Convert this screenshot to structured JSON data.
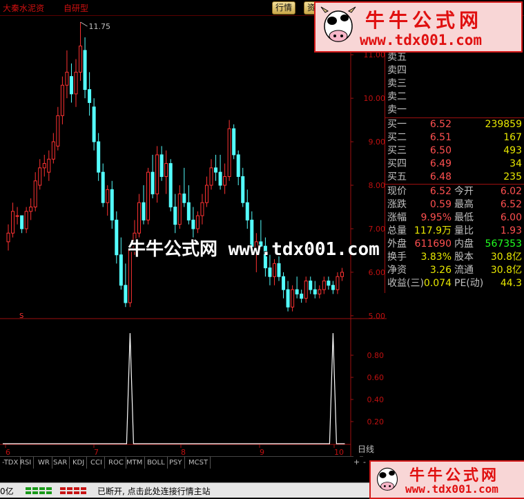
{
  "window": {
    "title": "大秦水泥资",
    "subtitle": "自研型"
  },
  "top_tabs": [
    {
      "label": "行情"
    },
    {
      "label": "资"
    }
  ],
  "chart_data": [
    {
      "type": "candlestick",
      "y_ticks": [
        "11.00",
        "10.00",
        "9.00",
        "8.00",
        "7.00",
        "6.00",
        "5.00"
      ],
      "ylim": [
        4.95,
        11.75
      ],
      "max_label": "11.75",
      "up_color": "#ff3232",
      "down_color": "#54ffff",
      "candles": [
        [
          6.7,
          7.1,
          6.5,
          6.9
        ],
        [
          6.9,
          7.6,
          6.8,
          7.4
        ],
        [
          7.3,
          7.5,
          7.1,
          7.3
        ],
        [
          7.3,
          7.2,
          6.9,
          7.0
        ],
        [
          7.0,
          7.5,
          6.9,
          7.4
        ],
        [
          7.4,
          7.7,
          7.2,
          7.5
        ],
        [
          7.5,
          8.3,
          7.4,
          8.1
        ],
        [
          8.0,
          8.6,
          7.9,
          8.4
        ],
        [
          8.4,
          8.7,
          8.2,
          8.5
        ],
        [
          8.3,
          8.8,
          8.1,
          8.6
        ],
        [
          8.6,
          9.2,
          8.5,
          9.0
        ],
        [
          8.9,
          9.8,
          8.8,
          9.6
        ],
        [
          9.6,
          10.5,
          9.4,
          10.3
        ],
        [
          10.3,
          11.1,
          10.0,
          10.6
        ],
        [
          10.5,
          10.8,
          9.9,
          10.1
        ],
        [
          10.1,
          10.9,
          9.8,
          10.6
        ],
        [
          10.6,
          11.75,
          10.4,
          11.2
        ],
        [
          11.1,
          11.4,
          10.0,
          10.2
        ],
        [
          10.2,
          10.6,
          9.6,
          9.9
        ],
        [
          9.8,
          10.0,
          8.8,
          9.0
        ],
        [
          9.0,
          9.2,
          8.1,
          8.3
        ],
        [
          8.3,
          8.5,
          7.5,
          7.6
        ],
        [
          7.6,
          8.0,
          7.3,
          7.9
        ],
        [
          7.9,
          8.1,
          7.0,
          7.2
        ],
        [
          7.2,
          7.4,
          6.2,
          6.4
        ],
        [
          6.4,
          6.8,
          5.6,
          5.7
        ],
        [
          5.7,
          6.2,
          5.2,
          5.3
        ],
        [
          5.3,
          6.6,
          5.2,
          6.5
        ],
        [
          6.5,
          7.2,
          6.4,
          6.9
        ],
        [
          6.9,
          7.8,
          6.8,
          7.6
        ],
        [
          7.6,
          8.0,
          7.1,
          7.2
        ],
        [
          7.2,
          8.4,
          7.1,
          8.3
        ],
        [
          8.3,
          8.7,
          7.7,
          7.8
        ],
        [
          7.8,
          8.9,
          7.6,
          8.7
        ],
        [
          8.7,
          8.9,
          8.1,
          8.2
        ],
        [
          8.2,
          8.8,
          7.8,
          8.5
        ],
        [
          8.5,
          8.6,
          7.4,
          7.5
        ],
        [
          7.5,
          7.8,
          6.9,
          7.1
        ],
        [
          7.1,
          8.0,
          7.0,
          7.8
        ],
        [
          7.8,
          8.4,
          7.5,
          7.6
        ],
        [
          7.6,
          8.0,
          7.1,
          7.2
        ],
        [
          7.2,
          7.5,
          6.8,
          7.0
        ],
        [
          7.0,
          7.4,
          6.9,
          7.3
        ],
        [
          7.3,
          7.8,
          7.1,
          7.6
        ],
        [
          7.6,
          8.2,
          7.5,
          8.0
        ],
        [
          8.0,
          8.6,
          7.9,
          8.4
        ],
        [
          8.4,
          8.7,
          8.1,
          8.3
        ],
        [
          8.3,
          8.7,
          7.9,
          8.0
        ],
        [
          8.0,
          8.5,
          7.8,
          8.2
        ],
        [
          8.2,
          9.5,
          8.1,
          9.3
        ],
        [
          9.3,
          9.4,
          8.6,
          8.7
        ],
        [
          8.7,
          8.8,
          8.0,
          8.2
        ],
        [
          8.2,
          8.4,
          7.5,
          7.6
        ],
        [
          7.6,
          7.9,
          7.0,
          7.2
        ],
        [
          7.2,
          7.4,
          6.4,
          6.5
        ],
        [
          6.5,
          6.9,
          6.0,
          6.7
        ],
        [
          6.7,
          7.2,
          6.5,
          6.6
        ],
        [
          6.6,
          6.8,
          5.9,
          6.1
        ],
        [
          6.1,
          6.4,
          5.7,
          5.9
        ],
        [
          5.9,
          6.3,
          5.7,
          6.2
        ],
        [
          6.2,
          6.4,
          5.8,
          5.9
        ],
        [
          5.9,
          6.0,
          5.4,
          5.6
        ],
        [
          5.6,
          5.8,
          5.1,
          5.2
        ],
        [
          5.2,
          5.7,
          5.1,
          5.6
        ],
        [
          5.6,
          5.9,
          5.4,
          5.5
        ],
        [
          5.5,
          5.6,
          5.3,
          5.4
        ],
        [
          5.4,
          5.9,
          5.3,
          5.8
        ],
        [
          5.8,
          5.9,
          5.5,
          5.6
        ],
        [
          5.6,
          5.8,
          5.4,
          5.5
        ],
        [
          5.5,
          5.7,
          5.4,
          5.6
        ],
        [
          5.6,
          5.9,
          5.5,
          5.8
        ],
        [
          5.8,
          5.9,
          5.6,
          5.7
        ],
        [
          5.7,
          5.8,
          5.5,
          5.6
        ],
        [
          5.6,
          6.0,
          5.5,
          5.9
        ],
        [
          5.9,
          6.1,
          5.8,
          6.0
        ]
      ]
    },
    {
      "type": "line",
      "y_ticks": [
        "0.80",
        "0.60",
        "0.40",
        "0.20"
      ],
      "ylim": [
        0,
        1
      ],
      "color": "#ffffff",
      "series": [
        {
          "spikes": [
            {
              "at_index": 27,
              "value": 1.0
            },
            {
              "at_index": 72,
              "value": 1.0
            }
          ]
        }
      ]
    }
  ],
  "x_ticks": [
    "6",
    "7",
    "8",
    "9",
    "10"
  ],
  "period_label": "日线",
  "indicator_marker": "S",
  "quote_panel": {
    "sell_rows": [
      {
        "label": "卖五"
      },
      {
        "label": "卖四"
      },
      {
        "label": "卖三"
      },
      {
        "label": "卖二"
      },
      {
        "label": "卖一"
      }
    ],
    "buy_rows": [
      {
        "label": "买一",
        "price": "6.52",
        "qty": "239859"
      },
      {
        "label": "买二",
        "price": "6.51",
        "qty": "167"
      },
      {
        "label": "买三",
        "price": "6.50",
        "qty": "493"
      },
      {
        "label": "买四",
        "price": "6.49",
        "qty": "34"
      },
      {
        "label": "买五",
        "price": "6.48",
        "qty": "235"
      }
    ],
    "stats": [
      {
        "l1": "现价",
        "v1": "6.52",
        "c1": "#ff5050",
        "l2": "今开",
        "v2": "6.02",
        "c2": "#ff5050"
      },
      {
        "l1": "涨跌",
        "v1": "0.59",
        "c1": "#ff5050",
        "l2": "最高",
        "v2": "6.52",
        "c2": "#ff5050"
      },
      {
        "l1": "涨幅",
        "v1": "9.95%",
        "c1": "#ff5050",
        "l2": "最低",
        "v2": "6.00",
        "c2": "#ff5050"
      },
      {
        "l1": "总量",
        "v1": "117.9万",
        "c1": "#e8e800",
        "l2": "量比",
        "v2": "1.93",
        "c2": "#ff5050"
      },
      {
        "l1": "外盘",
        "v1": "611690",
        "c1": "#ff5050",
        "l2": "内盘",
        "v2": "567353",
        "c2": "#20ff20"
      },
      {
        "l1": "换手",
        "v1": "3.83%",
        "c1": "#e8e800",
        "l2": "股本",
        "v2": "30.8亿",
        "c2": "#e8e800"
      },
      {
        "l1": "净资",
        "v1": "3.26",
        "c1": "#e8e800",
        "l2": "流通",
        "v2": "30.8亿",
        "c2": "#e8e800"
      },
      {
        "l1": "收益(三)",
        "v1": "0.074",
        "c1": "#e8e800",
        "l2": "PE(动)",
        "v2": "44.3",
        "c2": "#e8e800"
      }
    ]
  },
  "indicator_tabs": [
    "-TDX",
    "RSI",
    "WR",
    "SAR",
    "KDJ",
    "CCI",
    "ROC",
    "MTM",
    "BOLL",
    "PSY",
    "MCST"
  ],
  "tab_controls": {
    "plus": "+",
    "minus": "-"
  },
  "status_bar": {
    "volume_label": "0亿",
    "message": "已断开, 点击此处连接行情主站"
  },
  "watermarks": {
    "brand_cn": "牛牛公式网",
    "brand_url": "www.tdx001.com",
    "center_text": "牛牛公式网 www.tdx001.com"
  }
}
